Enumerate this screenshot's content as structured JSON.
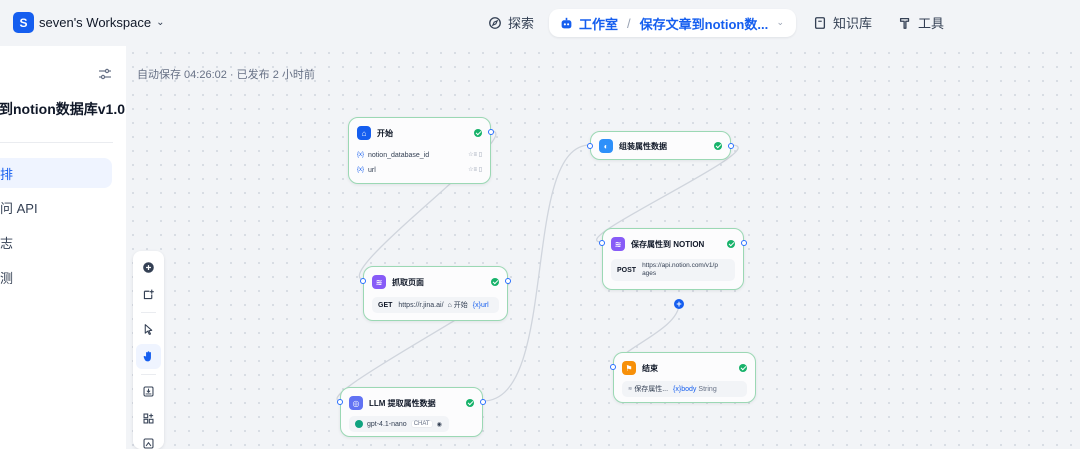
{
  "header": {
    "workspace_initial": "S",
    "workspace_name": "seven's Workspace",
    "nav_explore": "探索",
    "nav_studio": "工作室",
    "nav_app": "保存文章到notion数...",
    "nav_knowledge": "知识库",
    "nav_tools": "工具"
  },
  "sidebar": {
    "app_title": "到notion数据库v1.0",
    "items": [
      {
        "label": "排",
        "active": true
      },
      {
        "label": "问 API",
        "active": false
      },
      {
        "label": "志",
        "active": false
      },
      {
        "label": "测",
        "active": false
      }
    ]
  },
  "canvas": {
    "autosave": "自动保存 04:26:02 · 已发布 2 小时前"
  },
  "nodes": {
    "start": {
      "title": "开始",
      "vars": [
        {
          "tag": "{x}",
          "name": "notion_database_id"
        },
        {
          "tag": "{x}",
          "name": "url"
        }
      ]
    },
    "fetch": {
      "title": "抓取页面",
      "method": "GET",
      "url": "https://r.jina.ai/",
      "ref_node": "开始",
      "ref_var": "url"
    },
    "llm": {
      "title": "LLM 提取属性数据",
      "model": "gpt-4.1-nano",
      "model_tag": "CHAT"
    },
    "assemble": {
      "title": "组装属性数据"
    },
    "save": {
      "title": "保存属性到 NOTION",
      "method": "POST",
      "url_line1": "https://api.notion.com/v1/p",
      "url_line2": "ages"
    },
    "end": {
      "title": "结束",
      "output_node": "保存属性...",
      "output_var": "body",
      "output_type": "String"
    }
  },
  "colors": {
    "accent": "#155eef",
    "success": "#17b26a",
    "node_border": "#9bd8b4",
    "http_icon": "#875bf7",
    "llm_icon": "#6172f3",
    "code_icon": "#2e90fa",
    "end_icon": "#f79009"
  }
}
